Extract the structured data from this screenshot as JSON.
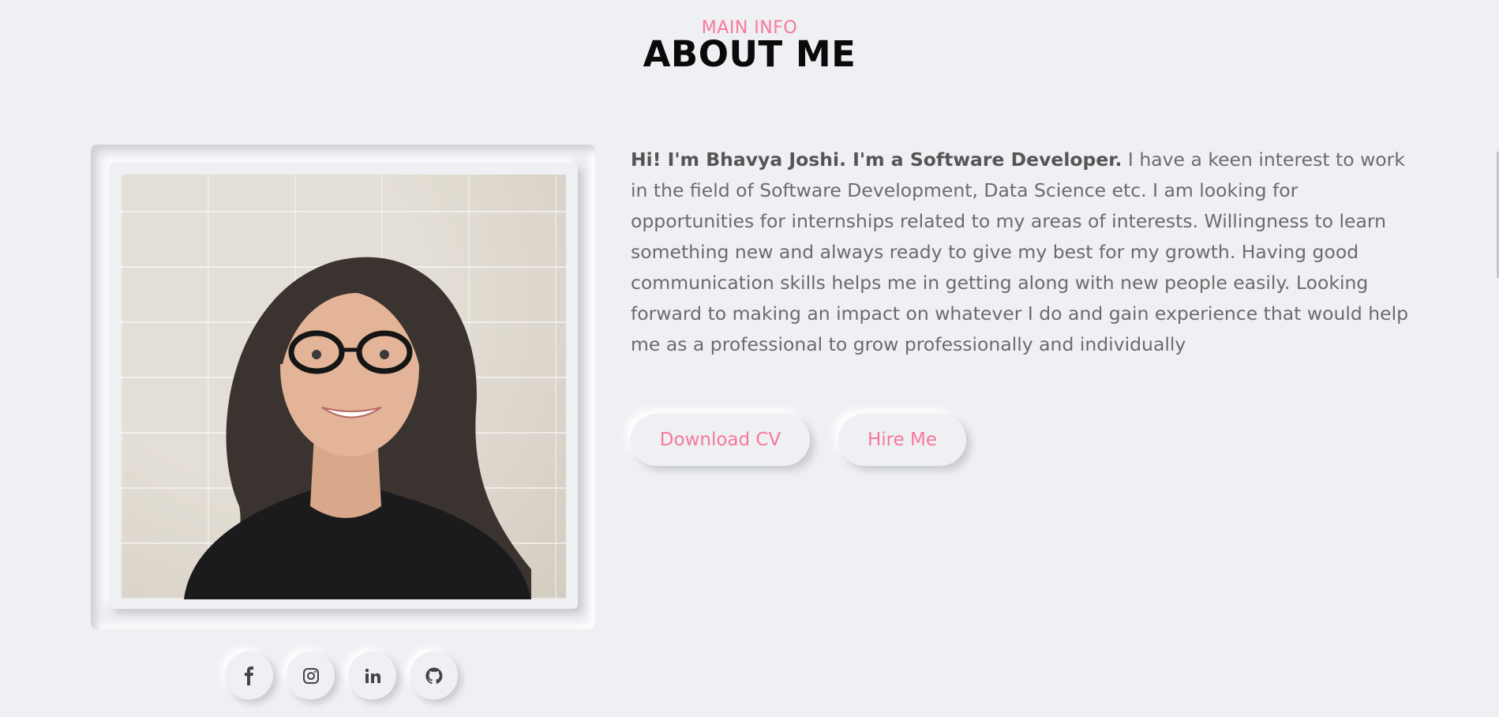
{
  "header": {
    "subtitle": "MAIN INFO",
    "title": "ABOUT ME"
  },
  "photo": {
    "subject": "portrait-photo"
  },
  "socials": [
    {
      "name": "facebook-icon",
      "glyph": "f"
    },
    {
      "name": "instagram-icon",
      "glyph": ""
    },
    {
      "name": "linkedin-icon",
      "glyph": "in"
    },
    {
      "name": "github-icon",
      "glyph": ""
    }
  ],
  "bio": {
    "intro": "Hi! I'm Bhavya Joshi. I'm a Software Developer.",
    "text": " I have a keen interest to work in the field of Software Development, Data Science etc. I am looking for opportunities for internships related to my areas of interests. Willingness to learn something new and always ready to give my best for my growth. Having good communication skills helps me in getting along with new people easily. Looking forward to making an impact on whatever I do and gain experience that would help me as a professional to grow professionally and individually"
  },
  "buttons": {
    "download_cv": "Download CV",
    "hire_me": "Hire Me"
  },
  "colors": {
    "accent": "#f7799a",
    "background": "#eff0f4",
    "text": "#6b6b6b"
  }
}
